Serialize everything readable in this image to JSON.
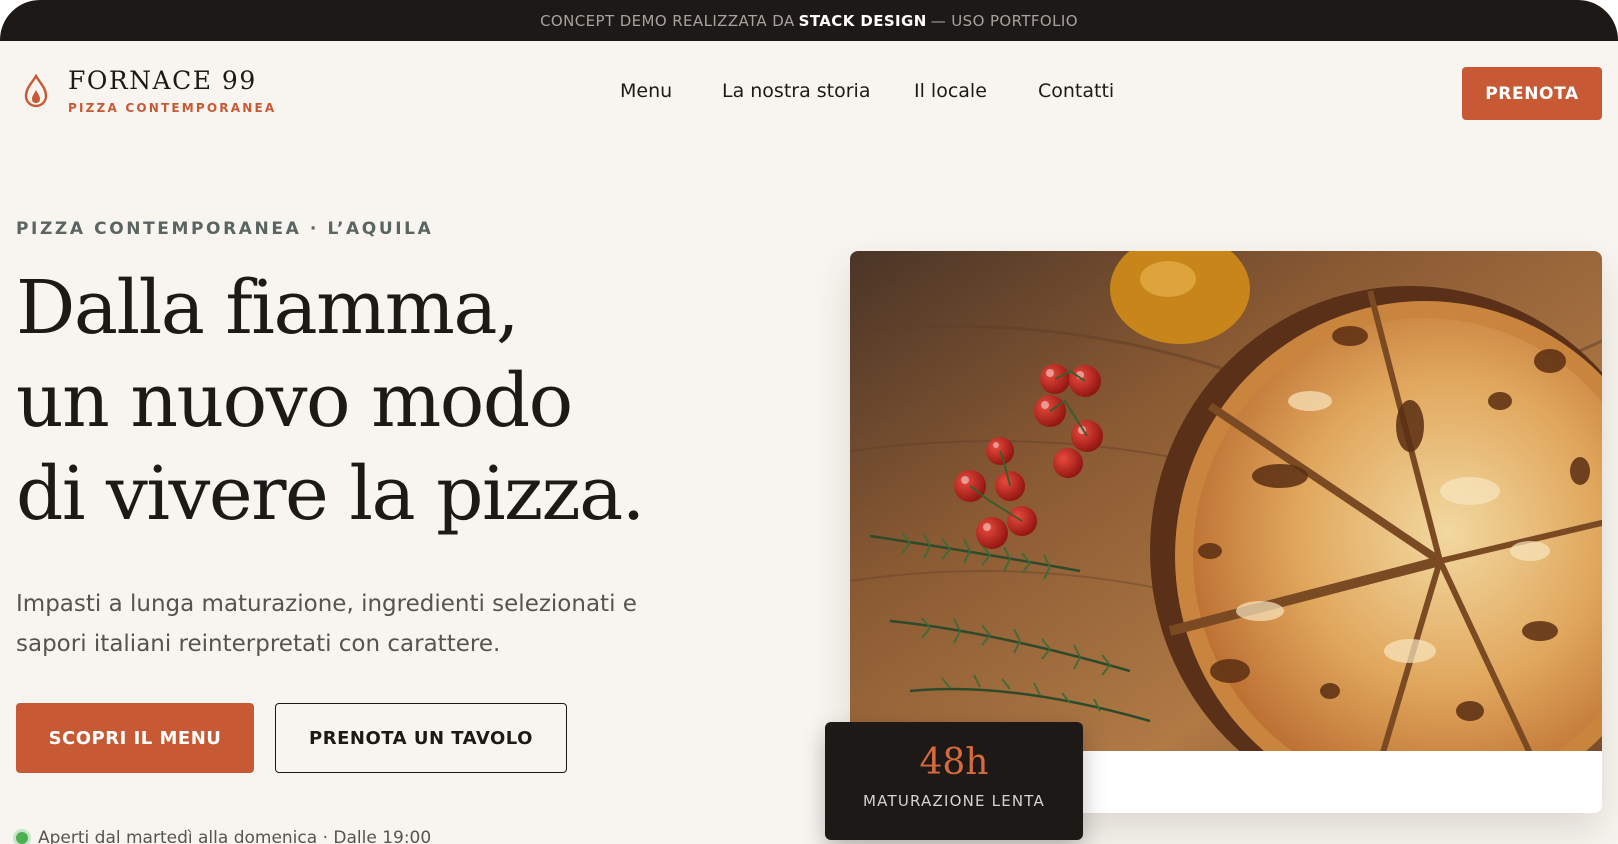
{
  "banner": {
    "prefix": "CONCEPT DEMO REALIZZATA DA",
    "brand": "STACK DESIGN",
    "suffix": "— USO PORTFOLIO"
  },
  "header": {
    "logo_icon": "flame-icon",
    "logo_title": "FORNACE 99",
    "logo_subtitle": "PIZZA CONTEMPORANEA",
    "nav": [
      {
        "label": "Menu"
      },
      {
        "label": "La nostra storia"
      },
      {
        "label": "Il locale"
      },
      {
        "label": "Contatti"
      }
    ],
    "cta_label": "PRENOTA"
  },
  "hero": {
    "eyebrow": "PIZZA CONTEMPORANEA · L’AQUILA",
    "headline": [
      "Dalla fiamma,",
      "un nuovo modo",
      "di vivere la pizza."
    ],
    "lead_line1": "Impasti a lunga maturazione, ingredienti selezionati e",
    "lead_line2": "sapori italiani reinterpretati con carattere.",
    "primary_button": "SCOPRI IL MENU",
    "secondary_button": "PRENOTA UN TAVOLO",
    "hours": "Aperti dal martedì alla domenica · Dalle 19:00",
    "image_icon": "pizza-photo",
    "badge": {
      "value": "48h",
      "label": "MATURAZIONE LENTA"
    }
  },
  "colors": {
    "accent": "#c75a34",
    "dark": "#1d1917",
    "background": "#f8f5f0"
  }
}
